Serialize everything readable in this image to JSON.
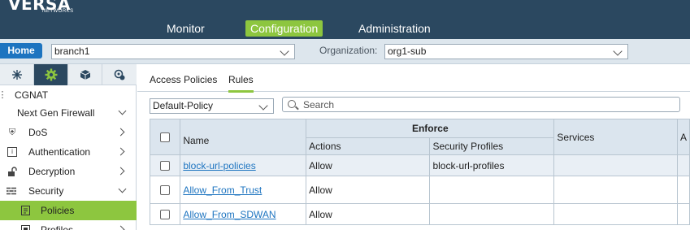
{
  "app": {
    "logo_text": "VERSA",
    "logo_sub": "NETWORKS"
  },
  "nav": {
    "items": [
      {
        "label": "Monitor"
      },
      {
        "label": "Configuration",
        "active": true
      },
      {
        "label": "Administration"
      }
    ]
  },
  "context": {
    "home_label": "Home",
    "device_value": "branch1",
    "org_label": "Organization:",
    "org_value": "org1-sub"
  },
  "sidebar": {
    "tabs": [
      {
        "icon": "network-icon"
      },
      {
        "icon": "gear-icon",
        "active": true
      },
      {
        "icon": "cube-icon"
      },
      {
        "icon": "shield-gear-icon"
      }
    ],
    "items": [
      {
        "label": "CGNAT",
        "icon": "grid-icon"
      },
      {
        "label": "Next Gen Firewall",
        "expanded": true
      },
      {
        "label": "DoS",
        "icon": "dos-icon"
      },
      {
        "label": "Authentication",
        "icon": "auth-icon"
      },
      {
        "label": "Decryption",
        "icon": "unlock-icon"
      },
      {
        "label": "Security",
        "icon": "firewall-icon",
        "expanded": true
      },
      {
        "label": "Policies",
        "icon": "document-icon",
        "selected": true
      },
      {
        "label": "Profiles",
        "icon": "profile-icon"
      }
    ]
  },
  "content": {
    "tabs": [
      {
        "label": "Access Policies"
      },
      {
        "label": "Rules",
        "active": true
      }
    ],
    "policy_select": "Default-Policy",
    "search_placeholder": "Search"
  },
  "table": {
    "headers": {
      "name": "Name",
      "enforce": "Enforce",
      "actions": "Actions",
      "security_profiles": "Security Profiles",
      "services": "Services",
      "next": "A"
    },
    "rows": [
      {
        "name": "block-url-policies",
        "action": "Allow",
        "profile": "block-url-profiles",
        "services": ""
      },
      {
        "name": "Allow_From_Trust",
        "action": "Allow",
        "profile": "",
        "services": ""
      },
      {
        "name": "Allow_From_SDWAN",
        "action": "Allow",
        "profile": "",
        "services": ""
      }
    ]
  },
  "colors": {
    "topbar": "#2b4860",
    "accent": "#8dc63f",
    "link": "#1d74c0",
    "header": "#dbe5ee"
  }
}
